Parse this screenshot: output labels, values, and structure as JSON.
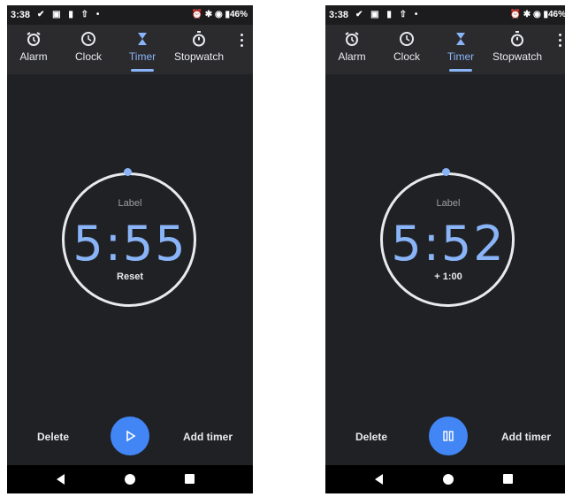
{
  "screens": [
    {
      "status": {
        "time": "3:38",
        "battery": "46%"
      },
      "tabs": [
        {
          "label": "Alarm",
          "icon": "alarm-icon"
        },
        {
          "label": "Clock",
          "icon": "clock-icon"
        },
        {
          "label": "Timer",
          "icon": "hourglass-icon",
          "active": true
        },
        {
          "label": "Stopwatch",
          "icon": "stopwatch-icon"
        }
      ],
      "timer": {
        "label": "Label",
        "value": "5:55",
        "action": "Reset"
      },
      "buttons": {
        "delete": "Delete",
        "add": "Add timer",
        "fab_state": "play"
      }
    },
    {
      "status": {
        "time": "3:38",
        "battery": "46%"
      },
      "tabs": [
        {
          "label": "Alarm",
          "icon": "alarm-icon"
        },
        {
          "label": "Clock",
          "icon": "clock-icon"
        },
        {
          "label": "Timer",
          "icon": "hourglass-icon",
          "active": true
        },
        {
          "label": "Stopwatch",
          "icon": "stopwatch-icon"
        }
      ],
      "timer": {
        "label": "Label",
        "value": "5:52",
        "action": "+ 1:00"
      },
      "buttons": {
        "delete": "Delete",
        "add": "Add timer",
        "fab_state": "pause"
      }
    }
  ],
  "colors": {
    "accent": "#8ab4f8",
    "fab": "#4285f4",
    "background": "#202124"
  }
}
